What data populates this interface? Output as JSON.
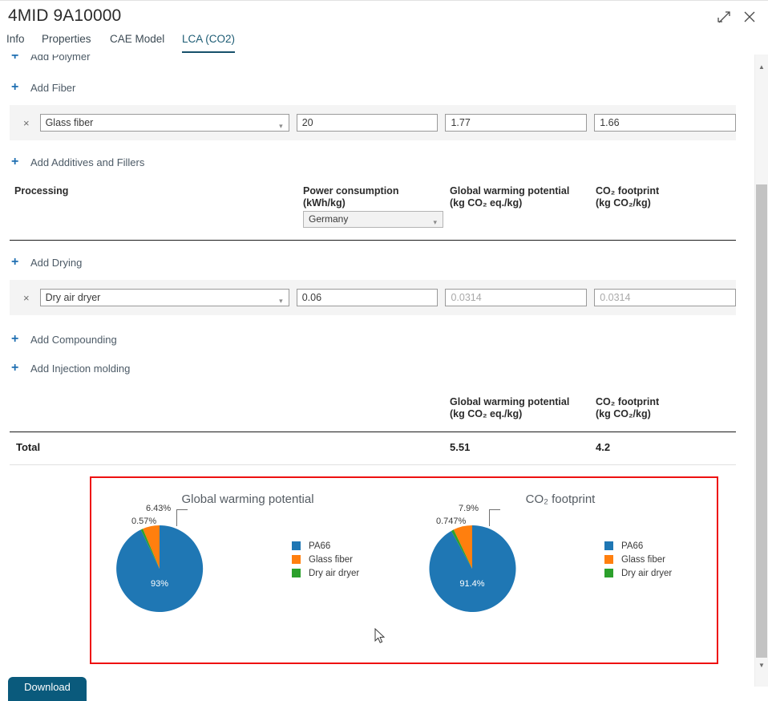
{
  "window": {
    "title": "4MID 9A10000",
    "expand_icon": "expand-icon",
    "close_icon": "close-icon"
  },
  "tabs": [
    {
      "label": "Info",
      "active": false
    },
    {
      "label": "Properties",
      "active": false
    },
    {
      "label": "CAE Model",
      "active": false
    },
    {
      "label": "LCA (CO2)",
      "active": true
    }
  ],
  "add_links": {
    "polymer": "Add Polymer",
    "fiber": "Add Fiber",
    "additives": "Add Additives and Fillers",
    "drying": "Add Drying",
    "compounding": "Add Compounding",
    "injection": "Add Injection molding"
  },
  "fiber_row": {
    "remove_icon": "×",
    "material": "Glass fiber",
    "amount": "20",
    "gwp": "1.77",
    "co2": "1.66"
  },
  "processing": {
    "col_process": "Processing",
    "col_power": "Power consumption",
    "col_power_unit": "(kWh/kg)",
    "col_gwp": "Global warming potential",
    "col_gwp_unit": "(kg CO₂ eq./kg)",
    "col_co2": "CO₂ footprint",
    "col_co2_unit": "(kg CO₂/kg)",
    "country": "Germany"
  },
  "drying_row": {
    "remove_icon": "×",
    "process": "Dry air dryer",
    "power": "0.06",
    "gwp": "0.0314",
    "co2": "0.0314"
  },
  "summary": {
    "col_gwp": "Global warming potential",
    "col_gwp_unit": "(kg CO₂ eq./kg)",
    "col_co2": "CO₂ footprint",
    "col_co2_unit": "(kg CO₂/kg)",
    "total_label": "Total",
    "total_gwp": "5.51",
    "total_co2": "4.2"
  },
  "bottom_button": {
    "label": "Download"
  },
  "colors": {
    "pa66": "#1f77b4",
    "glass_fiber": "#ff7f0e",
    "dry_air_dryer": "#2ca02c",
    "highlight_border": "#ee1111",
    "accent_blue": "#1f6fb2",
    "tab_active": "#17506b"
  },
  "chart_data": [
    {
      "type": "pie",
      "title": "Global warming potential",
      "categories": [
        "PA66",
        "Glass fiber",
        "Dry air dryer"
      ],
      "values": [
        93,
        6.43,
        0.57
      ],
      "labels": [
        "93%",
        "6.43%",
        "0.57%"
      ],
      "colors": [
        "#1f77b4",
        "#ff7f0e",
        "#2ca02c"
      ],
      "legend_position": "right",
      "inside_label": "93%",
      "outside_labels": [
        "6.43%",
        "0.57%"
      ]
    },
    {
      "type": "pie",
      "title": "CO₂ footprint",
      "categories": [
        "PA66",
        "Glass fiber",
        "Dry air dryer"
      ],
      "values": [
        91.4,
        7.9,
        0.747
      ],
      "labels": [
        "91.4%",
        "7.9%",
        "0.747%"
      ],
      "colors": [
        "#1f77b4",
        "#ff7f0e",
        "#2ca02c"
      ],
      "legend_position": "right",
      "inside_label": "91.4%",
      "outside_labels": [
        "7.9%",
        "0.747%"
      ]
    }
  ]
}
